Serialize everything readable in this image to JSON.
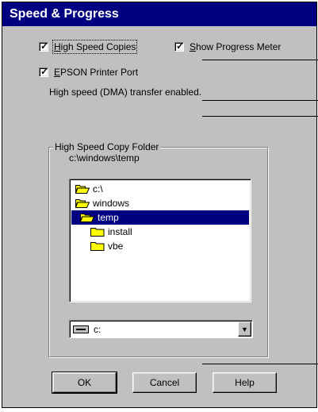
{
  "window": {
    "title": "Speed & Progress"
  },
  "options": {
    "high_speed_copies": {
      "label_accel": "H",
      "label_rest": "igh Speed Copies",
      "checked": true
    },
    "show_progress_meter": {
      "label_accel": "S",
      "label_rest": "how Progress Meter",
      "checked": true
    },
    "epson_printer_port": {
      "label_accel": "E",
      "label_rest": "PSON Printer Port",
      "checked": true
    },
    "status_text": "High speed (DMA) transfer enabled."
  },
  "copy_folder": {
    "group_title": "High Speed Copy Folder",
    "current_path": "c:\\windows\\temp",
    "tree": [
      {
        "label": "c:\\",
        "state": "open"
      },
      {
        "label": "windows",
        "state": "open"
      },
      {
        "label": "temp",
        "state": "open",
        "selected": true
      },
      {
        "label": "install",
        "state": "closed"
      },
      {
        "label": "vbe",
        "state": "closed"
      }
    ],
    "drive": {
      "selected": "c:"
    }
  },
  "buttons": {
    "ok": "OK",
    "cancel": "Cancel",
    "help": "Help"
  },
  "colors": {
    "title_bar": "#000080",
    "face": "#c0c0c0",
    "selection": "#000080",
    "folder_yellow": "#ffff00"
  },
  "icons": {
    "checkbox_tick": "✓",
    "dropdown": "▼",
    "folder_open": "folder-open-icon",
    "folder_closed": "folder-closed-icon",
    "drive": "drive-icon"
  }
}
